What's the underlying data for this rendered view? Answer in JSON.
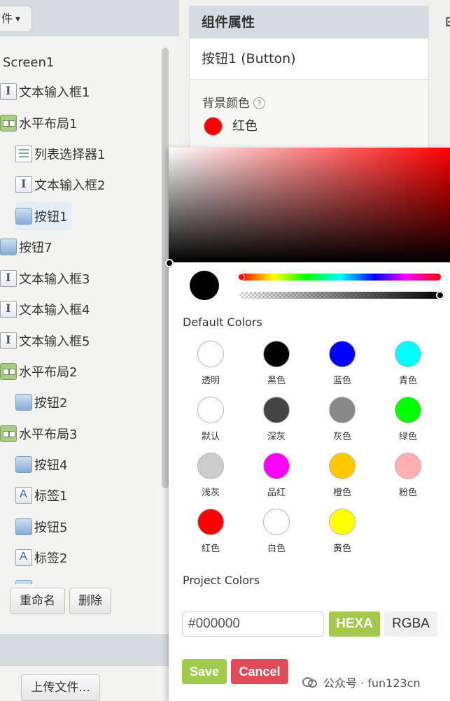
{
  "components_panel": {
    "top_dropdown_label": "件",
    "tree": [
      {
        "label": "Screen1",
        "icon": "none",
        "selected": false
      },
      {
        "label": "文本输入框1",
        "icon": "textbox-icon",
        "selected": false
      },
      {
        "label": "水平布局1",
        "icon": "horizontal-arrangement-icon",
        "selected": false
      },
      {
        "label": "列表选择器1",
        "icon": "listpicker-icon",
        "selected": false
      },
      {
        "label": "文本输入框2",
        "icon": "textbox-icon",
        "selected": false
      },
      {
        "label": "按钮1",
        "icon": "button-icon",
        "selected": true
      },
      {
        "label": "按钮7",
        "icon": "button-icon",
        "selected": false
      },
      {
        "label": "文本输入框3",
        "icon": "textbox-icon",
        "selected": false
      },
      {
        "label": "文本输入框4",
        "icon": "textbox-icon",
        "selected": false
      },
      {
        "label": "文本输入框5",
        "icon": "textbox-icon",
        "selected": false
      },
      {
        "label": "水平布局2",
        "icon": "horizontal-arrangement-icon",
        "selected": false
      },
      {
        "label": "按钮2",
        "icon": "button-icon",
        "selected": false
      },
      {
        "label": "水平布局3",
        "icon": "horizontal-arrangement-icon",
        "selected": false
      },
      {
        "label": "按钮4",
        "icon": "button-icon",
        "selected": false
      },
      {
        "label": "标签1",
        "icon": "label-icon",
        "selected": false
      },
      {
        "label": "按钮5",
        "icon": "button-icon",
        "selected": false
      },
      {
        "label": "标签2",
        "icon": "label-icon",
        "selected": false
      },
      {
        "label": "",
        "icon": "button-icon",
        "selected": false
      }
    ],
    "rename_button": "重命名",
    "delete_button": "删除",
    "upload_button": "上传文件..."
  },
  "properties_panel": {
    "title": "组件属性",
    "component_name": "按钮1 (Button)",
    "property_label": "背景颜色",
    "help_glyph": "?",
    "current_color_name": "红色",
    "current_color_hex": "#ff0000",
    "right_edge_text": "⊟"
  },
  "color_picker": {
    "hue_color": "#ff0000",
    "preview_color": "#000000",
    "default_colors_title": "Default Colors",
    "default_colors": [
      {
        "name": "透明",
        "hex": "#ffffff"
      },
      {
        "name": "黑色",
        "hex": "#000000"
      },
      {
        "name": "蓝色",
        "hex": "#0000ff"
      },
      {
        "name": "青色",
        "hex": "#00ffff"
      },
      {
        "name": "默认",
        "hex": "#ffffff"
      },
      {
        "name": "深灰",
        "hex": "#444444"
      },
      {
        "name": "灰色",
        "hex": "#888888"
      },
      {
        "name": "绿色",
        "hex": "#00ff00"
      },
      {
        "name": "浅灰",
        "hex": "#cccccc"
      },
      {
        "name": "品红",
        "hex": "#ff00ff"
      },
      {
        "name": "橙色",
        "hex": "#ffc800"
      },
      {
        "name": "粉色",
        "hex": "#ffafaf"
      },
      {
        "name": "红色",
        "hex": "#ff0000"
      },
      {
        "name": "白色",
        "hex": "#ffffff"
      },
      {
        "name": "黄色",
        "hex": "#ffff00"
      }
    ],
    "project_colors_title": "Project Colors",
    "hex_value": "#000000",
    "hexa_label": "HEXA",
    "rgba_label": "RGBA",
    "save_label": "Save",
    "cancel_label": "Cancel"
  },
  "watermark": {
    "text": "公众号 · fun123cn"
  }
}
